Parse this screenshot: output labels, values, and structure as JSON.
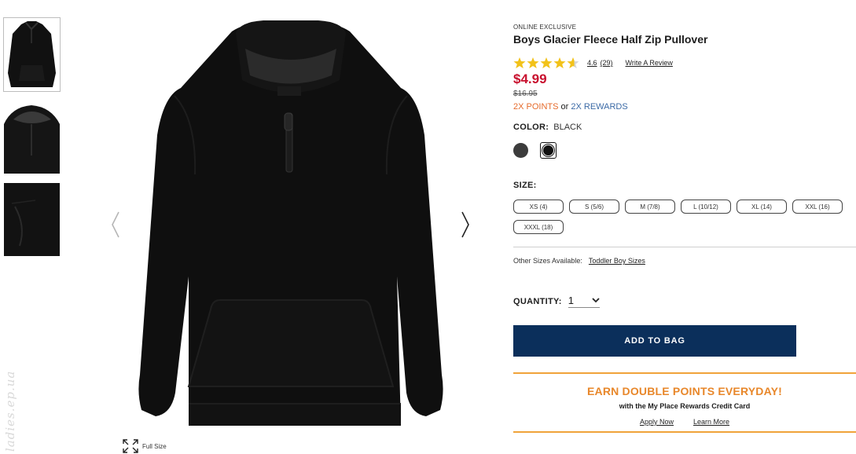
{
  "gallery": {
    "thumbnails": [
      "thumbnail-front",
      "thumbnail-collar",
      "thumbnail-pocket"
    ],
    "full_size_label": "Full Size",
    "watermark": "ladies.ep.ua"
  },
  "product": {
    "eyebrow": "ONLINE EXCLUSIVE",
    "title": "Boys Glacier Fleece Half Zip Pullover",
    "rating": "4.6",
    "review_count": "(29)",
    "rating_value": 4.6,
    "write_review": "Write A Review",
    "price": "$4.99",
    "original_price": "$16.95",
    "points": {
      "first": "2X POINTS",
      "or": "or",
      "second": "2X REWARDS"
    },
    "color_label": "COLOR:",
    "color_value": "BLACK",
    "swatches": [
      {
        "name": "gray",
        "color": "#3c3c3c"
      },
      {
        "name": "black",
        "color": "#111111",
        "selected": true
      }
    ],
    "size_label": "SIZE:",
    "sizes": [
      "XS (4)",
      "S (5/6)",
      "M (7/8)",
      "L (10/12)",
      "XL (14)",
      "XXL (16)",
      "XXXL (18)"
    ],
    "other_sizes_label": "Other Sizes Available:",
    "other_sizes_link": "Toddler Boy Sizes",
    "quantity_label": "QUANTITY:",
    "quantity_value": "1",
    "add_to_bag": "ADD TO BAG"
  },
  "promo": {
    "title": "EARN DOUBLE POINTS EVERYDAY!",
    "subtitle": "with the My Place Rewards Credit Card",
    "apply_now": "Apply Now",
    "learn_more": "Learn More"
  },
  "colors": {
    "price_red": "#c8102e",
    "points_orange": "#e66b2c",
    "rewards_blue": "#3b6aa6",
    "button_navy": "#0b2f5b",
    "promo_orange": "#e8872a",
    "star_gold": "#f2c21a"
  }
}
